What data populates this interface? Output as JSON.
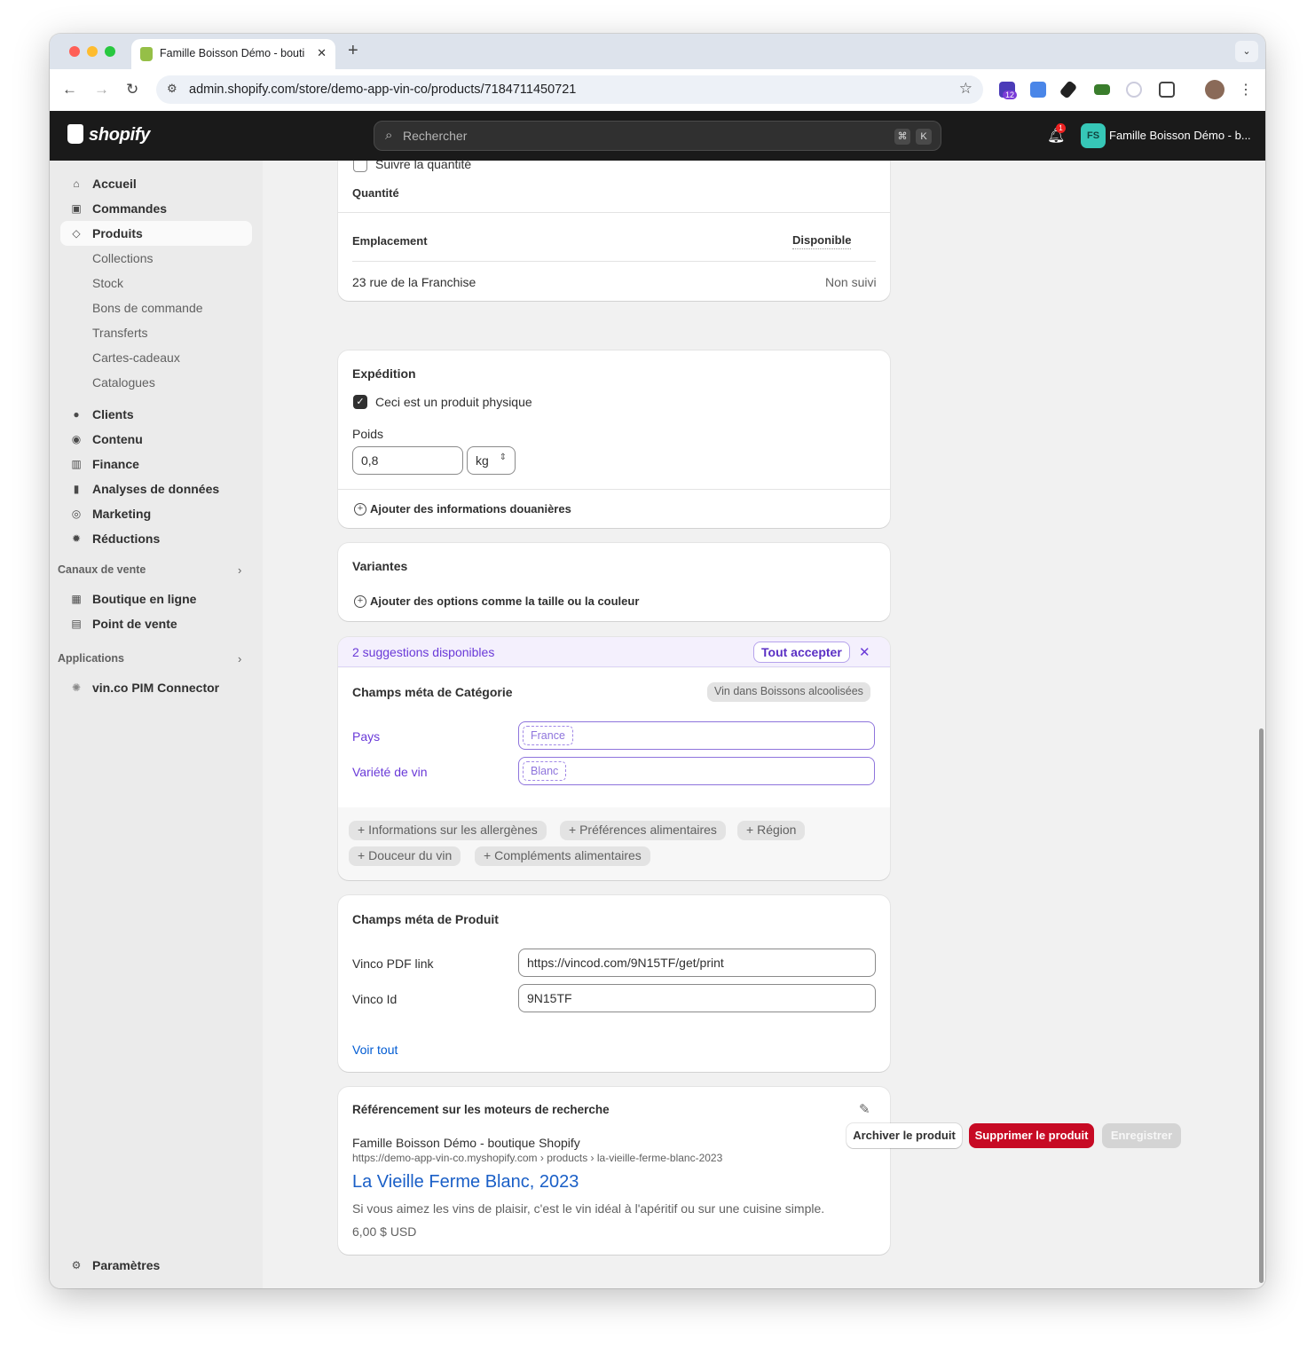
{
  "browser": {
    "tab_title": "Famille Boisson Démo - bouti",
    "url": "admin.shopify.com/store/demo-app-vin-co/products/7184711450721",
    "extension_badge": "12"
  },
  "header": {
    "logo_text": "shopify",
    "search_placeholder": "Rechercher",
    "kbd_cmd": "⌘",
    "kbd_k": "K",
    "notification_count": "1",
    "avatar_initials": "FS",
    "store_name": "Famille Boisson Démo - b..."
  },
  "sidebar": {
    "items": [
      {
        "label": "Accueil",
        "icon": "home-icon"
      },
      {
        "label": "Commandes",
        "icon": "inbox-icon"
      },
      {
        "label": "Produits",
        "icon": "tag-icon"
      },
      {
        "label": "Collections"
      },
      {
        "label": "Stock"
      },
      {
        "label": "Bons de commande"
      },
      {
        "label": "Transferts"
      },
      {
        "label": "Cartes-cadeaux"
      },
      {
        "label": "Catalogues"
      },
      {
        "label": "Clients",
        "icon": "person-icon"
      },
      {
        "label": "Contenu",
        "icon": "content-icon"
      },
      {
        "label": "Finance",
        "icon": "bank-icon"
      },
      {
        "label": "Analyses de données",
        "icon": "chart-icon"
      },
      {
        "label": "Marketing",
        "icon": "target-icon"
      },
      {
        "label": "Réductions",
        "icon": "discount-icon"
      }
    ],
    "sales_channels_title": "Canaux de vente",
    "sales_channels": [
      "Boutique en ligne",
      "Point de vente"
    ],
    "apps_title": "Applications",
    "apps": [
      "vin.co PIM Connector"
    ],
    "settings": "Paramètres"
  },
  "inventory": {
    "track_label": "Suivre la quantité",
    "quantity_title": "Quantité",
    "col_location": "Emplacement",
    "col_available": "Disponible",
    "row_location": "23 rue de la Franchise",
    "row_value": "Non suivi"
  },
  "shipping": {
    "title": "Expédition",
    "physical_label": "Ceci est un produit physique",
    "weight_label": "Poids",
    "weight_value": "0,8",
    "weight_unit": "kg",
    "customs_link": "Ajouter des informations douanières"
  },
  "variants": {
    "title": "Variantes",
    "add_options": "Ajouter des options comme la taille ou la couleur"
  },
  "suggestions": {
    "banner_text": "2 suggestions disponibles",
    "accept_all": "Tout accepter",
    "category_title": "Champs méta de Catégorie",
    "category_badge": "Vin dans Boissons alcoolisées",
    "fields": [
      {
        "label": "Pays",
        "value": "France"
      },
      {
        "label": "Variété de vin",
        "value": "Blanc"
      }
    ],
    "chips": [
      "Informations sur les allergènes",
      "Préférences alimentaires",
      "Région",
      "Douceur du vin",
      "Compléments alimentaires"
    ]
  },
  "product_meta": {
    "title": "Champs méta de Produit",
    "fields": [
      {
        "label": "Vinco PDF link",
        "value": "https://vincod.com/9N15TF/get/print"
      },
      {
        "label": "Vinco Id",
        "value": "9N15TF"
      }
    ],
    "see_all": "Voir tout"
  },
  "seo": {
    "title": "Référencement sur les moteurs de recherche",
    "store": "Famille Boisson Démo - boutique Shopify",
    "url": "https://demo-app-vin-co.myshopify.com › products › la-vieille-ferme-blanc-2023",
    "page_title": "La Vieille Ferme Blanc, 2023",
    "description": "Si vous aimez les vins de plaisir, c'est le vin idéal à l'apéritif ou sur une cuisine simple.",
    "price": "6,00 $ USD"
  },
  "actions": {
    "archive": "Archiver le produit",
    "delete": "Supprimer le produit",
    "save": "Enregistrer"
  },
  "colors": {
    "brand_dark": "#1a1a1a",
    "danger": "#c70a24",
    "suggestion_accent": "#6a3ad8",
    "link": "#005bd3"
  }
}
